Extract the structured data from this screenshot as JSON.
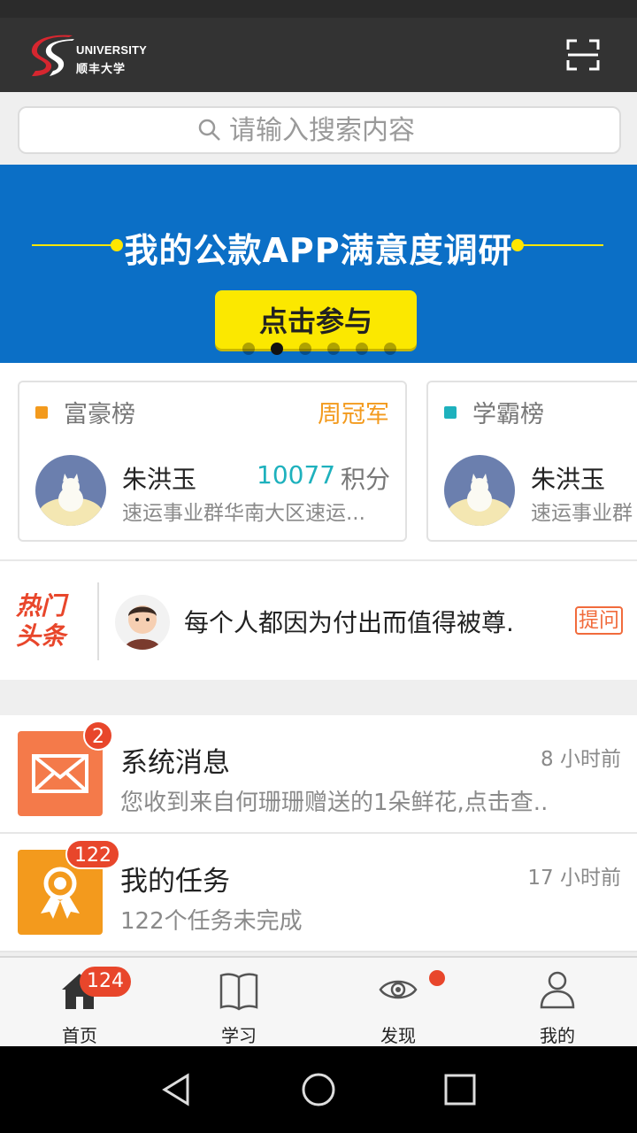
{
  "header": {
    "logo_en": "UNIVERSITY",
    "logo_cn": "顺丰大学",
    "scan_icon": "scan-icon"
  },
  "search": {
    "placeholder": "请输入搜索内容"
  },
  "banner": {
    "title": "我的公款APP满意度调研",
    "button": "点击参与",
    "slide_count": 6,
    "active_slide": 1
  },
  "ranks": [
    {
      "title": "富豪榜",
      "tag": "周冠军",
      "color": "#f39a1d",
      "name": "朱洪玉",
      "score": "10077",
      "unit": "积分",
      "dept": "速运事业群华南大区速运..."
    },
    {
      "title": "学霸榜",
      "color": "#1eb1bd",
      "name": "朱洪玉",
      "dept": "速运事业群"
    }
  ],
  "hot": {
    "logo_line1": "热门",
    "logo_line2": "头条",
    "text": "每个人都因为付出而值得被尊.",
    "ask": "提问"
  },
  "messages": [
    {
      "title": "系统消息",
      "time": "8 小时前",
      "sub": "您收到来自何珊珊赠送的1朵鲜花,点击查..",
      "badge": "2",
      "icon": "mail-icon",
      "color": "#f47a4a"
    },
    {
      "title": "我的任务",
      "time": "17 小时前",
      "sub": "122个任务未完成",
      "badge": "122",
      "icon": "award-icon",
      "color": "#f39a1d"
    }
  ],
  "tabs": [
    {
      "label": "首页",
      "icon": "home-icon",
      "badge": "124"
    },
    {
      "label": "学习",
      "icon": "book-icon"
    },
    {
      "label": "发现",
      "icon": "eye-icon"
    },
    {
      "label": "我的",
      "icon": "person-icon"
    }
  ]
}
